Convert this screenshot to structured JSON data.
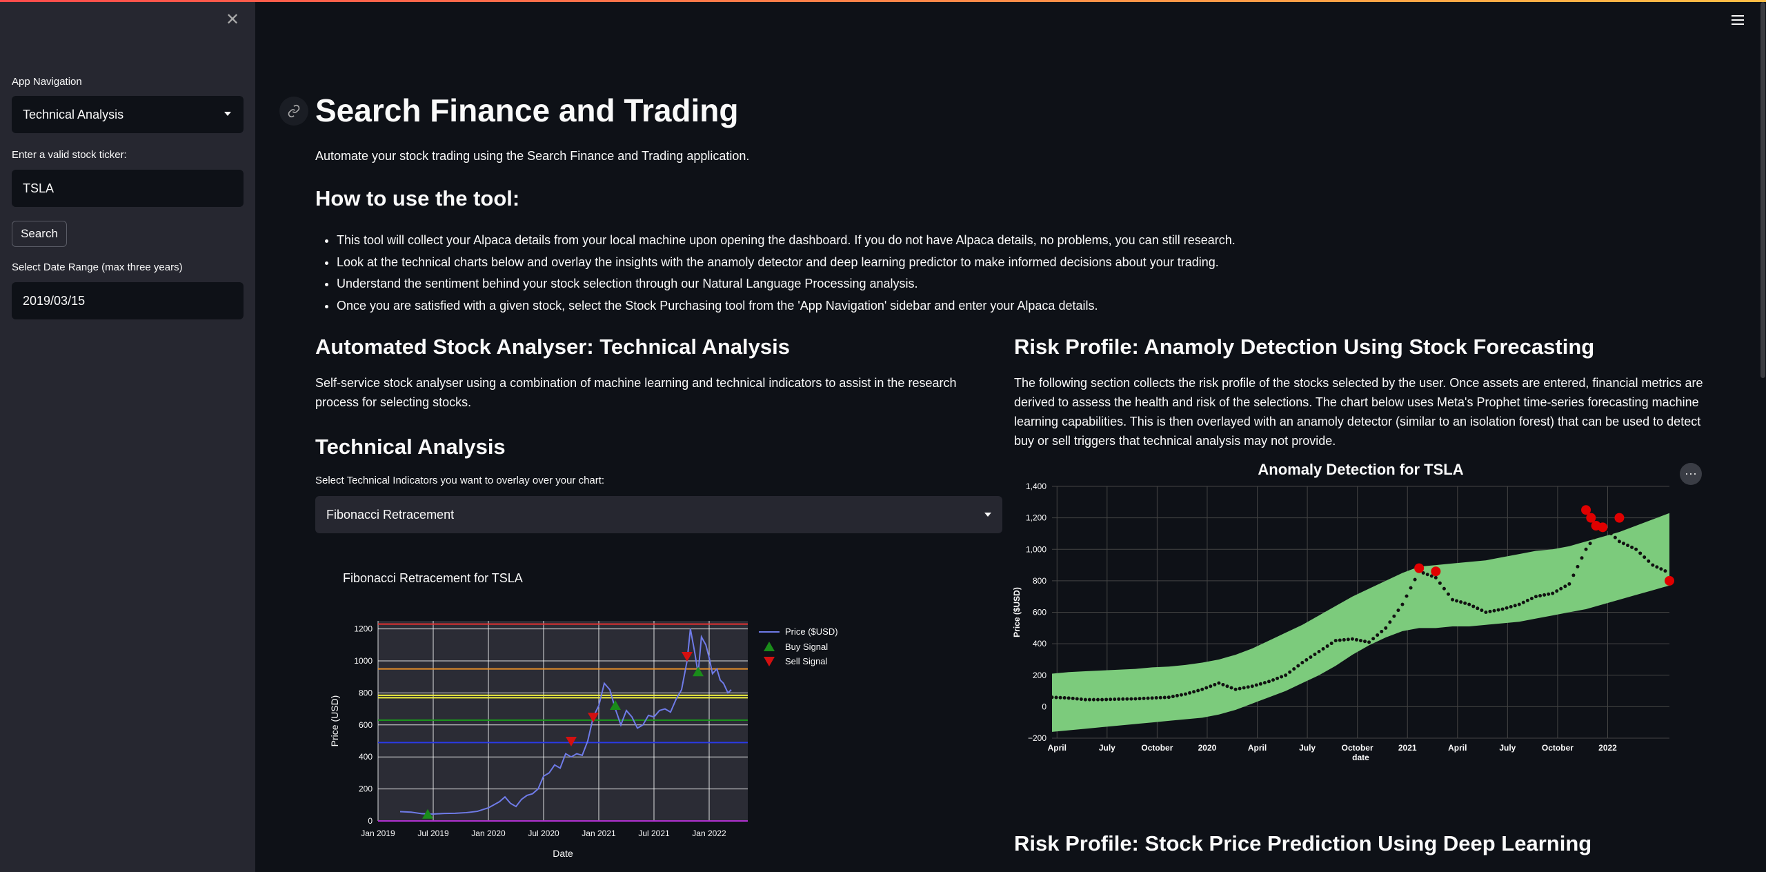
{
  "sidebar": {
    "nav_label": "App Navigation",
    "nav_value": "Technical Analysis",
    "ticker_label": "Enter a valid stock ticker:",
    "ticker_value": "TSLA",
    "search_button": "Search",
    "date_label": "Select Date Range (max three years)",
    "date_value": "2019/03/15"
  },
  "main": {
    "title": "Search Finance and Trading",
    "subtitle": "Automate your stock trading using the Search Finance and Trading application.",
    "howto_heading": "How to use the tool:",
    "bullets": [
      "This tool will collect your Alpaca details from your local machine upon opening the dashboard. If you do not have Alpaca details, no problems, you can still research.",
      "Look at the technical charts below and overlay the insights with the anamoly detector and deep learning predictor to make informed decisions about your trading.",
      "Understand the sentiment behind your stock selection through our Natural Language Processing analysis.",
      "Once you are satisfied with a given stock, select the Stock Purchasing tool from the 'App Navigation' sidebar and enter your Alpaca details."
    ],
    "left_heading": "Automated Stock Analyser: Technical Analysis",
    "left_desc": "Self-service stock analyser using a combination of machine learning and technical indicators to assist in the research process for selecting stocks.",
    "ta_heading": "Technical Analysis",
    "ta_select_label": "Select Technical Indicators you want to overlay over your chart:",
    "ta_select_value": "Fibonacci Retracement",
    "right_heading": "Risk Profile: Anamoly Detection Using Stock Forecasting",
    "right_desc": "The following section collects the risk profile of the stocks selected by the user. Once assets are entered, financial metrics are derived to assess the health and risk of the selections. The chart below uses Meta's Prophet time-series forecasting machine learning capabilities. This is then overlayed with an anamoly detector (similar to an isolation forest) that can be used to detect buy or sell triggers that technical analysis may not provide.",
    "bottom_heading": "Risk Profile: Stock Price Prediction Using Deep Learning"
  },
  "chart_data": [
    {
      "type": "line",
      "title": "Fibonacci Retracement for TSLA",
      "xlabel": "Date",
      "ylabel": "Price (USD)",
      "ylim": [
        0,
        1250
      ],
      "x_ticks": [
        "Jan 2019",
        "Jul 2019",
        "Jan 2020",
        "Jul 2020",
        "Jan 2021",
        "Jul 2021",
        "Jan 2022"
      ],
      "y_ticks": [
        "0",
        "200",
        "400",
        "600",
        "800",
        "1000",
        "1200"
      ],
      "legend": [
        "Price ($USD)",
        "Buy Signal",
        "Sell Signal"
      ],
      "legend_position": "right",
      "series": [
        {
          "name": "Price ($USD)",
          "color": "#6f7be8",
          "x": [
            2019.2,
            2019.3,
            2019.4,
            2019.5,
            2019.6,
            2019.7,
            2019.8,
            2019.9,
            2020.0,
            2020.1,
            2020.15,
            2020.2,
            2020.25,
            2020.3,
            2020.35,
            2020.4,
            2020.45,
            2020.5,
            2020.55,
            2020.6,
            2020.65,
            2020.7,
            2020.75,
            2020.8,
            2020.85,
            2020.9,
            2020.95,
            2021.0,
            2021.05,
            2021.1,
            2021.15,
            2021.2,
            2021.25,
            2021.3,
            2021.35,
            2021.4,
            2021.45,
            2021.5,
            2021.55,
            2021.6,
            2021.65,
            2021.7,
            2021.75,
            2021.8,
            2021.83,
            2021.87,
            2021.9,
            2021.93,
            2021.97,
            2022.0,
            2022.03,
            2022.07,
            2022.1,
            2022.13,
            2022.17,
            2022.2
          ],
          "y": [
            58,
            55,
            45,
            43,
            47,
            48,
            52,
            60,
            82,
            120,
            150,
            110,
            90,
            135,
            160,
            170,
            200,
            280,
            300,
            350,
            330,
            420,
            400,
            420,
            410,
            500,
            650,
            720,
            860,
            820,
            700,
            600,
            690,
            650,
            580,
            600,
            660,
            650,
            690,
            700,
            680,
            760,
            820,
            1000,
            1200,
            1050,
            920,
            1150,
            1100,
            1020,
            920,
            950,
            880,
            860,
            800,
            820
          ]
        },
        {
          "name": "Buy Signal",
          "color": "#1a8c1a",
          "x": [
            2019.45,
            2021.15,
            2021.9
          ],
          "y": [
            40,
            720,
            930
          ]
        },
        {
          "name": "Sell Signal",
          "color": "#d41010",
          "x": [
            2020.75,
            2020.95,
            2021.8
          ],
          "y": [
            500,
            650,
            1030
          ]
        }
      ],
      "hlines": [
        {
          "y": 1230,
          "color": "#e53030"
        },
        {
          "y": 950,
          "color": "#e8902a"
        },
        {
          "y": 785,
          "color": "#f0f040"
        },
        {
          "y": 770,
          "color": "#f0f040"
        },
        {
          "y": 630,
          "color": "#1a9c1a"
        },
        {
          "y": 490,
          "color": "#2a3ae8"
        },
        {
          "y": 0,
          "color": "#b030d0"
        }
      ]
    },
    {
      "type": "scatter",
      "title": "Anomaly Detection for TSLA",
      "xlabel": "date",
      "ylabel": "Price ($USD)",
      "ylim": [
        -200,
        1400
      ],
      "x_ticks": [
        "April",
        "July",
        "October",
        "2020",
        "April",
        "July",
        "October",
        "2021",
        "April",
        "July",
        "October",
        "2022"
      ],
      "y_ticks": [
        "−200",
        "0",
        "200",
        "400",
        "600",
        "800",
        "1,000",
        "1,200",
        "1,400"
      ],
      "band_color": "#7ccb7c",
      "band": {
        "x": [
          0,
          1,
          2,
          3,
          4,
          5,
          6,
          7,
          8,
          9,
          10,
          11,
          12,
          13,
          14,
          15,
          16,
          17,
          18,
          19,
          20,
          21,
          22,
          23,
          24,
          25,
          26,
          27,
          28,
          29,
          30,
          31,
          32,
          33,
          34,
          35,
          36,
          37
        ],
        "upper": [
          210,
          220,
          225,
          230,
          235,
          240,
          250,
          255,
          265,
          280,
          300,
          330,
          370,
          420,
          470,
          520,
          580,
          640,
          700,
          750,
          800,
          850,
          890,
          900,
          910,
          920,
          930,
          950,
          970,
          990,
          1000,
          1020,
          1050,
          1080,
          1110,
          1150,
          1190,
          1230
        ],
        "lower": [
          -160,
          -150,
          -140,
          -130,
          -120,
          -110,
          -100,
          -90,
          -80,
          -70,
          -50,
          -20,
          20,
          60,
          100,
          150,
          200,
          260,
          330,
          390,
          440,
          480,
          500,
          500,
          510,
          510,
          520,
          530,
          540,
          560,
          580,
          600,
          620,
          650,
          680,
          710,
          740,
          770
        ]
      },
      "actual": {
        "x": [
          0,
          1,
          2,
          3,
          4,
          5,
          6,
          7,
          8,
          9,
          10,
          11,
          12,
          13,
          14,
          15,
          16,
          17,
          18,
          19,
          20,
          21,
          22,
          23,
          24,
          25,
          26,
          27,
          28,
          29,
          30,
          31,
          32,
          33,
          34,
          35,
          36,
          37
        ],
        "y": [
          60,
          55,
          45,
          45,
          48,
          50,
          55,
          60,
          80,
          110,
          150,
          110,
          130,
          160,
          200,
          280,
          350,
          420,
          430,
          410,
          500,
          650,
          860,
          820,
          680,
          650,
          600,
          620,
          650,
          700,
          720,
          780,
          1000,
          1150,
          1050,
          1000,
          900,
          850
        ]
      },
      "anomalies": {
        "color": "#e00000",
        "x": [
          22,
          23,
          32,
          32.3,
          32.6,
          33,
          34,
          37
        ],
        "y": [
          880,
          860,
          1250,
          1200,
          1150,
          1140,
          1200,
          800
        ]
      }
    }
  ],
  "colors": {
    "background": "#0e1117",
    "sidebar": "#262730",
    "accent": "#ff4b4b"
  }
}
